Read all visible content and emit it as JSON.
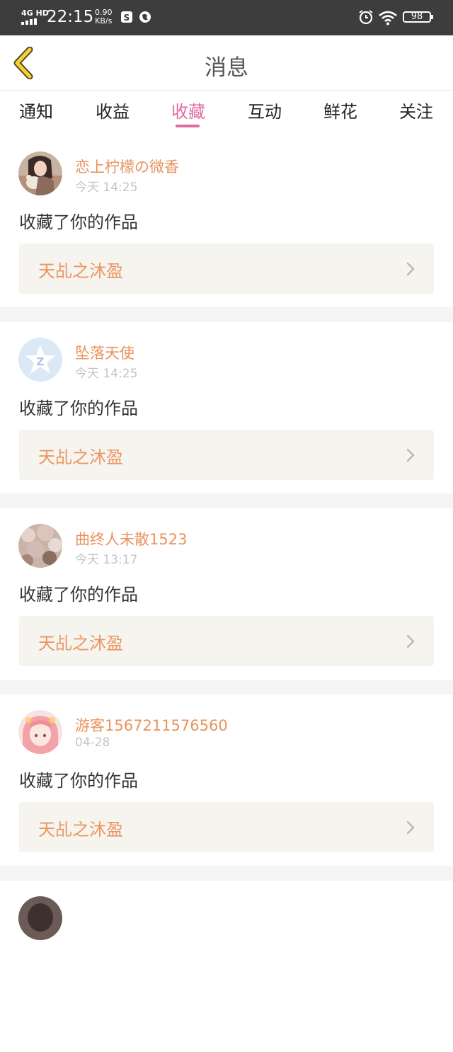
{
  "status_bar": {
    "network": "4G HD",
    "time": "22:15",
    "speed_value": "0.90",
    "speed_unit": "KB/s",
    "battery": "98"
  },
  "nav": {
    "title": "消息"
  },
  "tabs": [
    {
      "label": "通知",
      "active": false
    },
    {
      "label": "收益",
      "active": false
    },
    {
      "label": "收藏",
      "active": true
    },
    {
      "label": "互动",
      "active": false
    },
    {
      "label": "鲜花",
      "active": false
    },
    {
      "label": "关注",
      "active": false
    }
  ],
  "feed": [
    {
      "username": "恋上柠檬の微香",
      "time": "今天 14:25",
      "action": "收藏了你的作品",
      "work": "天乩之沐盈"
    },
    {
      "username": "坠落天使",
      "time": "今天 14:25",
      "action": "收藏了你的作品",
      "work": "天乩之沐盈"
    },
    {
      "username": "曲终人未散1523",
      "time": "今天 13:17",
      "action": "收藏了你的作品",
      "work": "天乩之沐盈"
    },
    {
      "username": "游客1567211576560",
      "time": "04-28",
      "action": "收藏了你的作品",
      "work": "天乩之沐盈"
    }
  ],
  "colors": {
    "accent": "#e26aa3",
    "username": "#e8935e",
    "work_title": "#ec9560",
    "status_bar_bg": "#3d3d3d"
  }
}
